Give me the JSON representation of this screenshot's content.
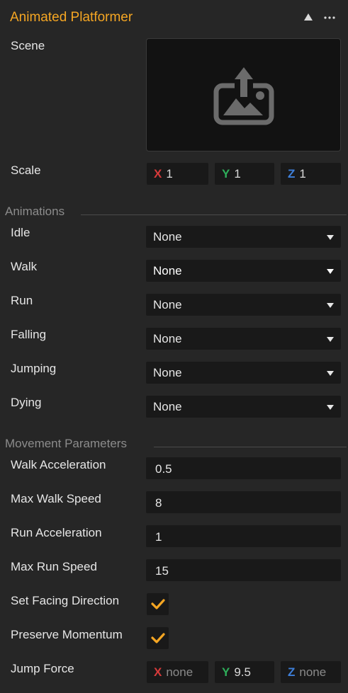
{
  "header": {
    "title": "Animated Platformer",
    "collapse_icon": "triangle-up-icon",
    "more_icon": "ellipsis-icon"
  },
  "scene": {
    "label": "Scene",
    "drop_icon": "image-upload-icon"
  },
  "scale": {
    "label": "Scale",
    "x_axis": "X",
    "x": "1",
    "y_axis": "Y",
    "y": "1",
    "z_axis": "Z",
    "z": "1"
  },
  "animations": {
    "title": "Animations",
    "items": [
      {
        "label": "Idle",
        "value": "None"
      },
      {
        "label": "Walk",
        "value": "None"
      },
      {
        "label": "Run",
        "value": "None"
      },
      {
        "label": "Falling",
        "value": "None"
      },
      {
        "label": "Jumping",
        "value": "None"
      },
      {
        "label": "Dying",
        "value": "None"
      }
    ]
  },
  "movement": {
    "title": "Movement Parameters",
    "walk_acceleration": {
      "label": "Walk Acceleration",
      "value": "0.5"
    },
    "max_walk_speed": {
      "label": "Max Walk Speed",
      "value": "8"
    },
    "run_acceleration": {
      "label": "Run Acceleration",
      "value": "1"
    },
    "max_run_speed": {
      "label": "Max Run Speed",
      "value": "15"
    },
    "set_facing_direction": {
      "label": "Set Facing Direction",
      "checked": true
    },
    "preserve_momentum": {
      "label": "Preserve Momentum",
      "checked": true
    },
    "jump_force": {
      "label": "Jump Force",
      "x_axis": "X",
      "x": "none",
      "y_axis": "Y",
      "y": "9.5",
      "z_axis": "Z",
      "z": "none"
    }
  },
  "colors": {
    "accent": "#f5a623",
    "background": "#262626",
    "field": "#191919",
    "axis_x": "#d63a3a",
    "axis_y": "#2eae5a",
    "axis_z": "#3e7fd9"
  }
}
